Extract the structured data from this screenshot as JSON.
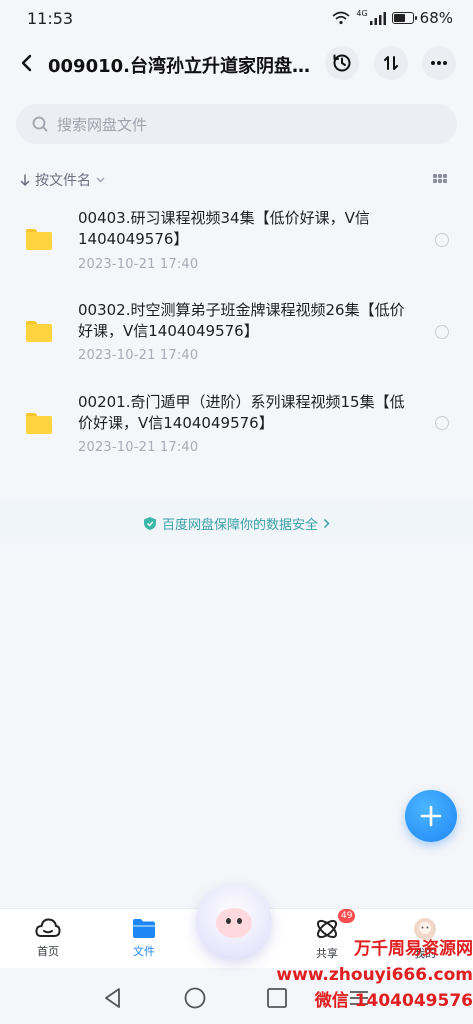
{
  "status_bar": {
    "time": "11:53",
    "network_label": "4G",
    "battery": "68%",
    "battery_level": 0.68
  },
  "header": {
    "title": "009010.台湾孙立升道家阴盘...",
    "history_icon": "history-icon",
    "sort_icon": "sort-arrows-icon",
    "more_icon": "more-icon"
  },
  "search": {
    "placeholder": "搜索网盘文件"
  },
  "sort": {
    "label": "按文件名"
  },
  "files": [
    {
      "name": "00403.研习课程视频34集【低价好课，V信1404049576】",
      "date": "2023-10-21  17:40"
    },
    {
      "name": "00302.时空测算弟子班金牌课程视频26集【低价好课，V信1404049576】",
      "date": "2023-10-21  17:40"
    },
    {
      "name": "00201.奇门遁甲（进阶）系列课程视频15集【低价好课，V信1404049576】",
      "date": "2023-10-21  17:40"
    }
  ],
  "safety_banner": {
    "text": "百度网盘保障你的数据安全"
  },
  "tabs": [
    {
      "label": "首页",
      "icon": "home-cloud-icon"
    },
    {
      "label": "文件",
      "icon": "folder-icon"
    },
    {
      "label": "共享",
      "icon": "share-orbit-icon",
      "badge": "49"
    },
    {
      "label": "我的",
      "icon": "avatar-icon"
    }
  ],
  "watermark": {
    "line1": "万千周易资源网",
    "line2": "www.zhouyi666.com",
    "line3": "微信 1404049576"
  },
  "colors": {
    "accent": "#1f86f5",
    "folder": "#ffd43f",
    "safety_text": "#3aa0a8",
    "watermark": "#e02020"
  }
}
